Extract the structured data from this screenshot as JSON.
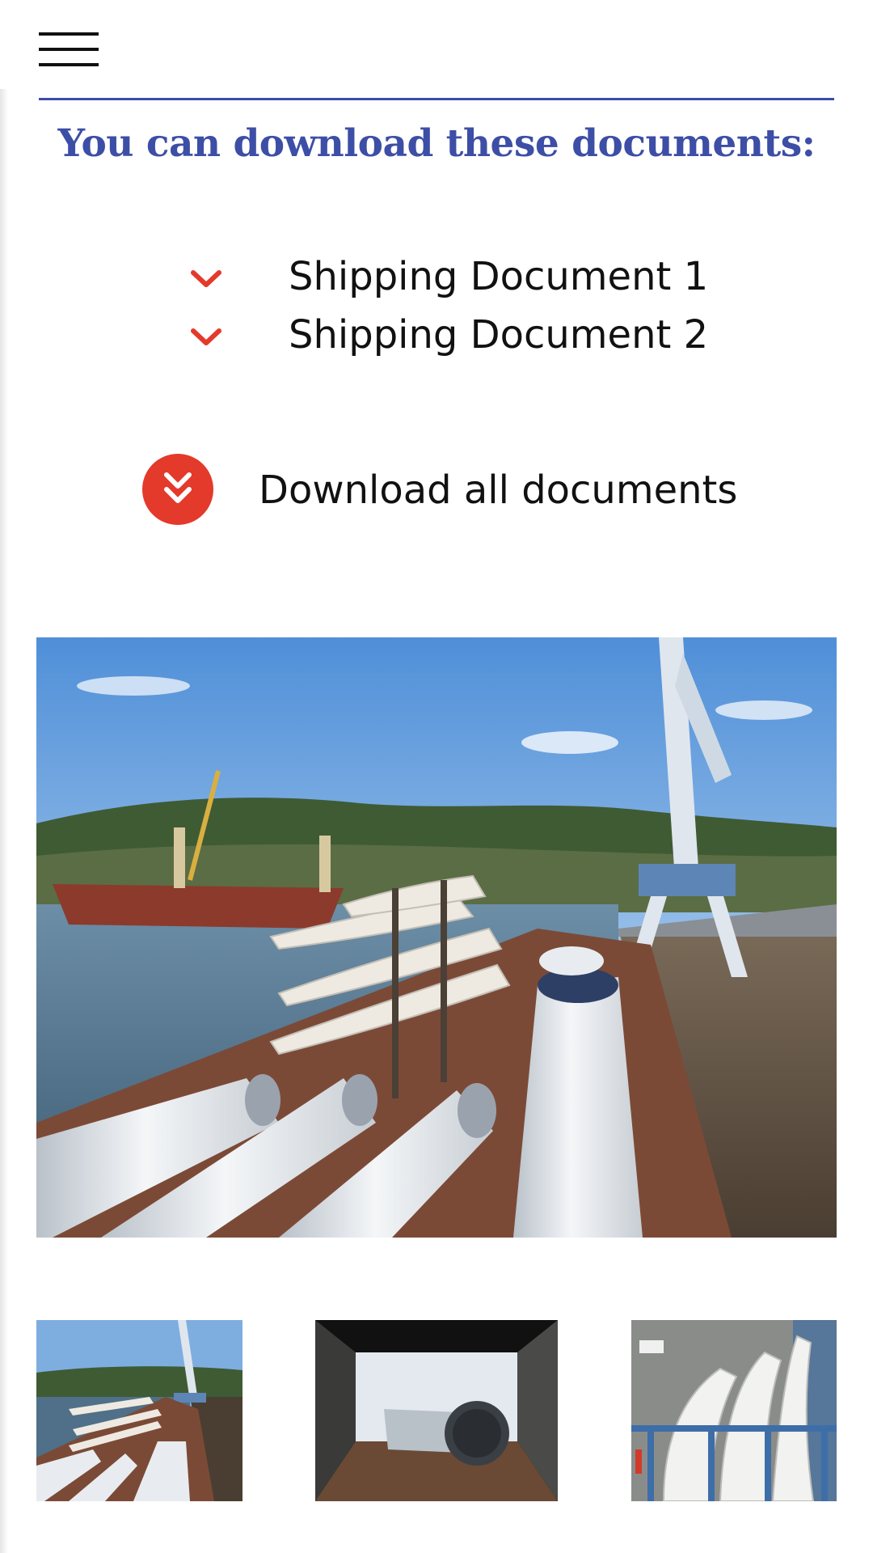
{
  "header": {
    "menu_icon": "hamburger-menu-icon",
    "rule_color": "#3d4ea6"
  },
  "main": {
    "heading": "You can download these documents:",
    "heading_color": "#3d4ea6",
    "documents": [
      {
        "label": "Shipping Document 1",
        "icon": "chevron-down-icon"
      },
      {
        "label": "Shipping Document 2",
        "icon": "chevron-down-icon"
      }
    ],
    "download_all": {
      "label": "Download all documents",
      "icon": "double-chevron-down-icon",
      "accent_color": "#e33a2b"
    }
  },
  "gallery": {
    "hero": "port-wind-turbine-cargo-photo",
    "thumbnails": [
      "port-wind-turbine-cargo-thumbnail",
      "ship-hold-tank-thumbnail",
      "turbine-blades-deck-thumbnail"
    ]
  }
}
